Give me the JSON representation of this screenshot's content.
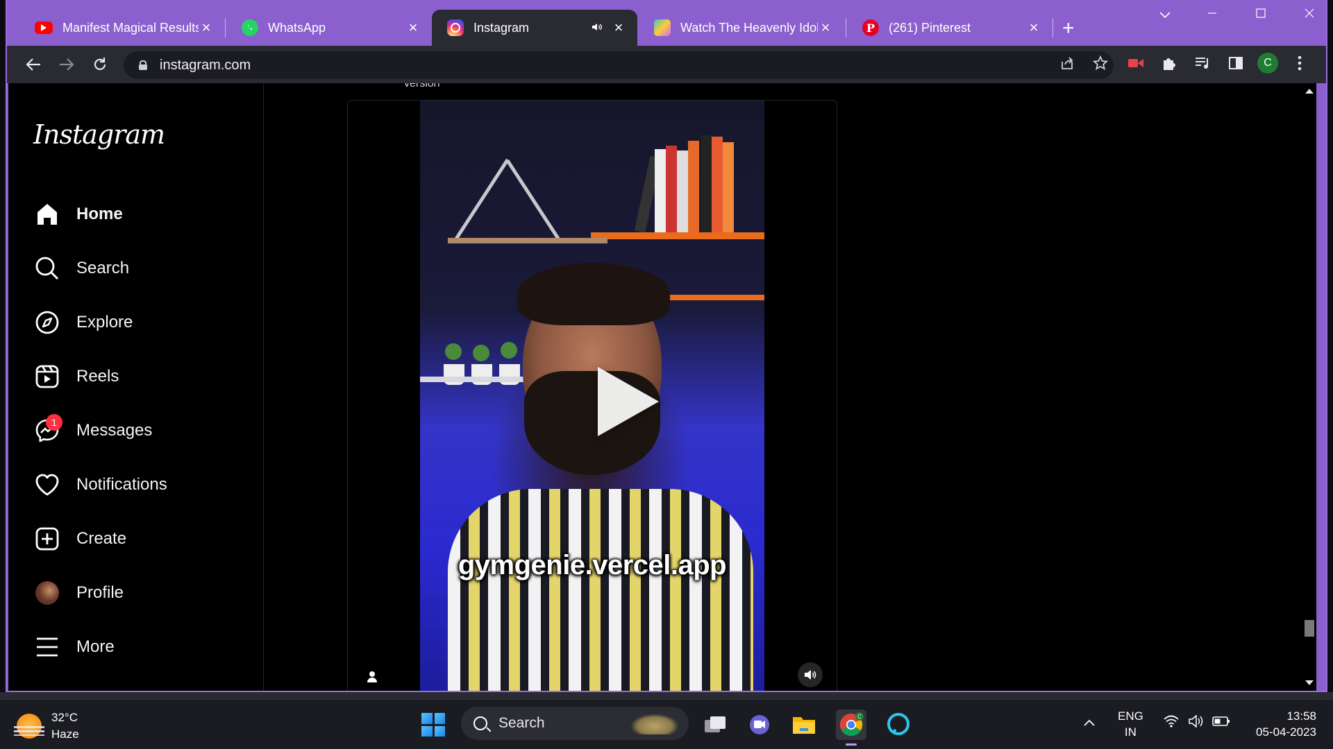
{
  "browser": {
    "tabs": [
      {
        "title": "Manifest Magical Results",
        "favicon": "youtube-icon",
        "active": false
      },
      {
        "title": "WhatsApp",
        "favicon": "whatsapp-icon",
        "active": false
      },
      {
        "title": "Instagram",
        "favicon": "instagram-icon",
        "active": true,
        "audio": true
      },
      {
        "title": "Watch The Heavenly Idol",
        "favicon": "bilibili-icon",
        "active": false
      },
      {
        "title": "(261) Pinterest",
        "favicon": "pinterest-icon",
        "active": false
      }
    ],
    "new_tab": "+",
    "address": "instagram.com",
    "profile_initial": "C",
    "accent": "#8c5fce"
  },
  "instagram": {
    "logo": "Instagram",
    "nav": [
      {
        "label": "Home",
        "icon": "home-icon",
        "active": true
      },
      {
        "label": "Search",
        "icon": "search-icon"
      },
      {
        "label": "Explore",
        "icon": "compass-icon"
      },
      {
        "label": "Reels",
        "icon": "reels-icon"
      },
      {
        "label": "Messages",
        "icon": "messenger-icon",
        "badge": "1"
      },
      {
        "label": "Notifications",
        "icon": "heart-icon"
      },
      {
        "label": "Create",
        "icon": "plus-square-icon"
      },
      {
        "label": "Profile",
        "icon": "avatar"
      },
      {
        "label": "More",
        "icon": "menu-icon"
      }
    ],
    "post": {
      "caption_cut": "version",
      "video_overlay_text": "gymgenie.vercel.app"
    }
  },
  "taskbar": {
    "weather_temp": "32°C",
    "weather_desc": "Haze",
    "search_label": "Search",
    "lang_top": "ENG",
    "lang_bottom": "IN",
    "time": "13:58",
    "date": "05-04-2023"
  }
}
